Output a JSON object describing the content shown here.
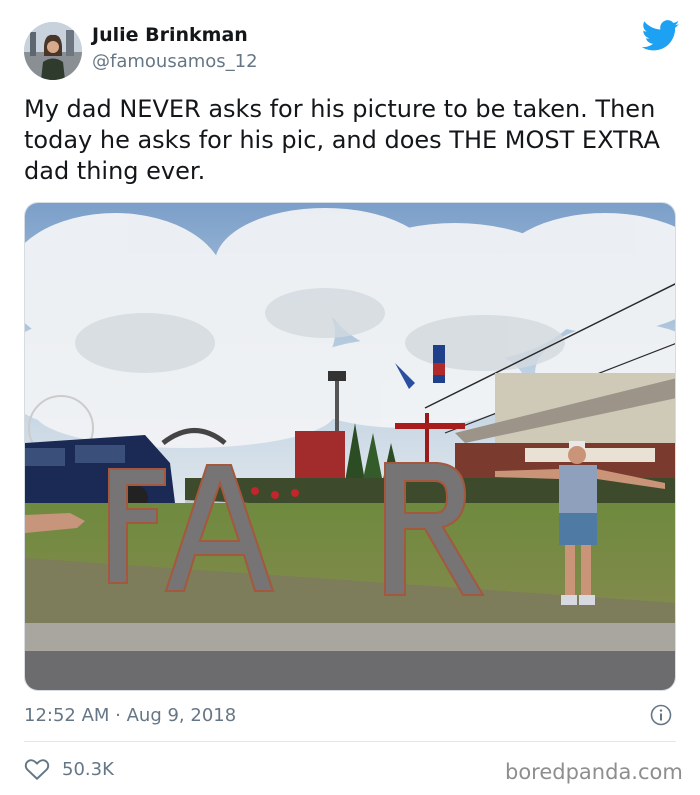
{
  "tweet": {
    "author_name": "Julie Brinkman",
    "author_handle": "@famousamos_12",
    "text": "My dad NEVER asks for his picture to be taken. Then today he asks for his pic, and does THE MOST EXTRA dad thing ever.",
    "timestamp": "12:52 AM · Aug 9, 2018",
    "like_count": "50.3K"
  },
  "photo": {
    "sign_letters": [
      "F",
      "A",
      "R"
    ]
  },
  "watermark": "boredpanda.com",
  "colors": {
    "twitter_blue": "#1da1f2",
    "secondary_text": "#657786",
    "primary_text": "#14171a"
  },
  "icons": [
    "twitter-bird-icon",
    "info-icon",
    "heart-icon"
  ]
}
